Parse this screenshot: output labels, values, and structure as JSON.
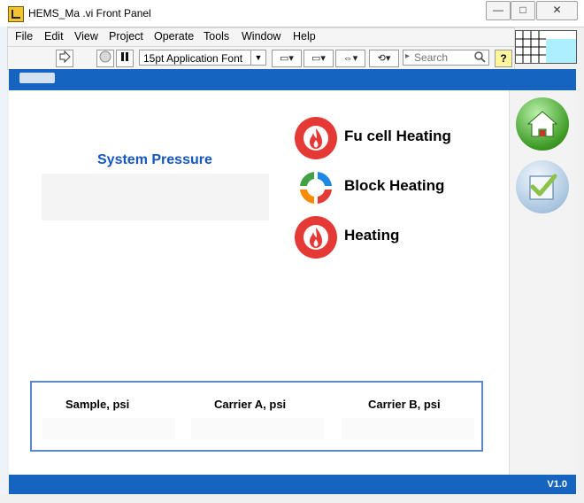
{
  "window": {
    "title": "HEMS_Ma     .vi Front Panel",
    "minimize": "—",
    "maximize": "□",
    "close": "✕"
  },
  "menu": [
    "File",
    "Edit",
    "View",
    "Project",
    "Operate",
    "Tools",
    "Window",
    "Help"
  ],
  "toolbar": {
    "font_value": "15pt Application Font",
    "search_placeholder": "Search",
    "help": "?"
  },
  "front_panel": {
    "system_pressure_label": "System Pressure",
    "status_indicators": [
      {
        "label": "Fu  cell Heating",
        "icon": "flame-icon",
        "color": "#e53935"
      },
      {
        "label": "Block Heating",
        "icon": "cycle-arrows-icon",
        "color": "#43a047"
      },
      {
        "label": "Heating",
        "icon": "flame-icon",
        "color": "#e53935"
      }
    ],
    "readouts": [
      "Sample, psi",
      "Carrier A, psi",
      "Carrier B, psi"
    ],
    "version": "V1.0"
  },
  "nav": {
    "home_icon": "home-icon",
    "check_icon": "check-icon"
  },
  "colors": {
    "band_blue": "#1565c0",
    "label_blue": "#1557c0",
    "frame_blue": "#5b86c9"
  }
}
